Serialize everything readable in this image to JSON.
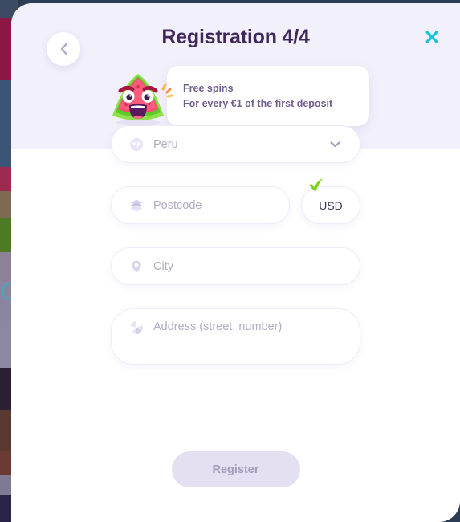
{
  "modal": {
    "title": "Registration 4/4",
    "back_icon": "chevron-left-icon",
    "close_icon": "close-icon",
    "close_color": "#19bfe5",
    "header_bg": "#f2f0fb",
    "title_color": "#40285c"
  },
  "bonus": {
    "mascot": "watermelon-mascot-icon",
    "text": "Free spins\nFor every €1 of the first deposit",
    "line1": "Free spins",
    "line2": "For every €1 of the first",
    "line3": "deposit",
    "text_color": "#6f5f8f"
  },
  "form": {
    "country": {
      "value": "Peru",
      "icon": "globe-icon",
      "chevron": "chevron-down-icon"
    },
    "postcode": {
      "placeholder": "Postcode",
      "value": "",
      "icon": "envelope-icon"
    },
    "currency": {
      "value": "USD",
      "check_icon": "check-icon",
      "check_color": "#7ed321"
    },
    "city": {
      "placeholder": "City",
      "value": "",
      "icon": "location-pin-icon"
    },
    "address": {
      "placeholder": "Address (street, number)",
      "value": "",
      "icon": "address-icon"
    }
  },
  "submit": {
    "label": "Register",
    "disabled": true,
    "bg": "#e4dff1",
    "text_color": "#a49bb9"
  }
}
